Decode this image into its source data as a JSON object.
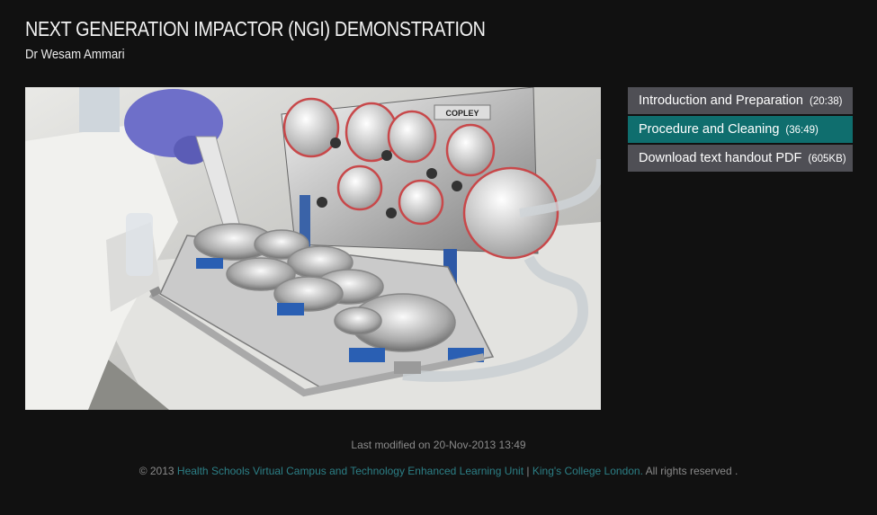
{
  "header": {
    "title": "NEXT GENERATION IMPACTOR (NGI) DEMONSTRATION",
    "author": "Dr Wesam Ammari"
  },
  "video": {
    "equipment_label": "COPLEY"
  },
  "menu": {
    "items": [
      {
        "label": "Introduction and Preparation",
        "duration": "(20:38)",
        "active": false
      },
      {
        "label": "Procedure and Cleaning",
        "duration": "(36:49)",
        "active": true
      },
      {
        "label": "Download text handout PDF",
        "duration": "(605KB)",
        "active": false
      }
    ]
  },
  "footer": {
    "last_modified": "Last modified on 20-Nov-2013 13:49",
    "copyright_prefix": "© 2013",
    "link_unit": "Health Schools Virtual Campus and Technology Enhanced Learning Unit",
    "separator": "|",
    "link_college": "King's College London.",
    "rights": "All rights reserved ."
  },
  "colors": {
    "background": "#111111",
    "menu_item": "#4f4f55",
    "menu_active": "#0f6e6e",
    "link": "#2c7f86"
  }
}
